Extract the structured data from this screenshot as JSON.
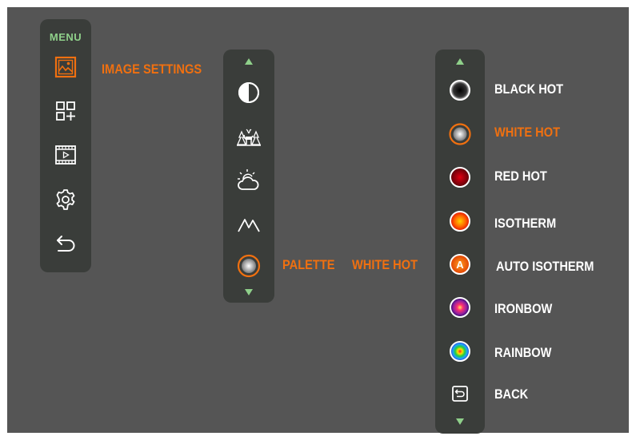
{
  "colors": {
    "accent": "#f07010",
    "menu_green": "#8fd08a",
    "panel_bg": "#3a3d3a",
    "screen_bg": "#555555"
  },
  "menu": {
    "title": "MENU",
    "items": [
      {
        "icon": "image-settings-icon",
        "selected": true
      },
      {
        "icon": "add-widget-icon",
        "selected": false
      },
      {
        "icon": "video-icon",
        "selected": false
      },
      {
        "icon": "gear-icon",
        "selected": false
      },
      {
        "icon": "back-arrow-icon",
        "selected": false
      }
    ]
  },
  "image_settings": {
    "label": "IMAGE SETTINGS",
    "items": [
      {
        "icon": "contrast-icon"
      },
      {
        "icon": "scene-mode-deer-icon"
      },
      {
        "icon": "weather-icon"
      },
      {
        "icon": "sharpness-wave-icon"
      },
      {
        "icon": "palette-icon",
        "selected": true
      }
    ],
    "palette_label": "PALETTE",
    "palette_value": "WHITE HOT"
  },
  "palettes": [
    {
      "label": "BLACK HOT",
      "selected": false
    },
    {
      "label": "WHITE HOT",
      "selected": true
    },
    {
      "label": "RED HOT",
      "selected": false
    },
    {
      "label": "ISOTHERM",
      "selected": false
    },
    {
      "label": "AUTO ISOTHERM",
      "selected": false,
      "badge": "A"
    },
    {
      "label": "IRONBOW",
      "selected": false
    },
    {
      "label": "RAINBOW",
      "selected": false
    },
    {
      "label": "BACK",
      "selected": false
    }
  ]
}
